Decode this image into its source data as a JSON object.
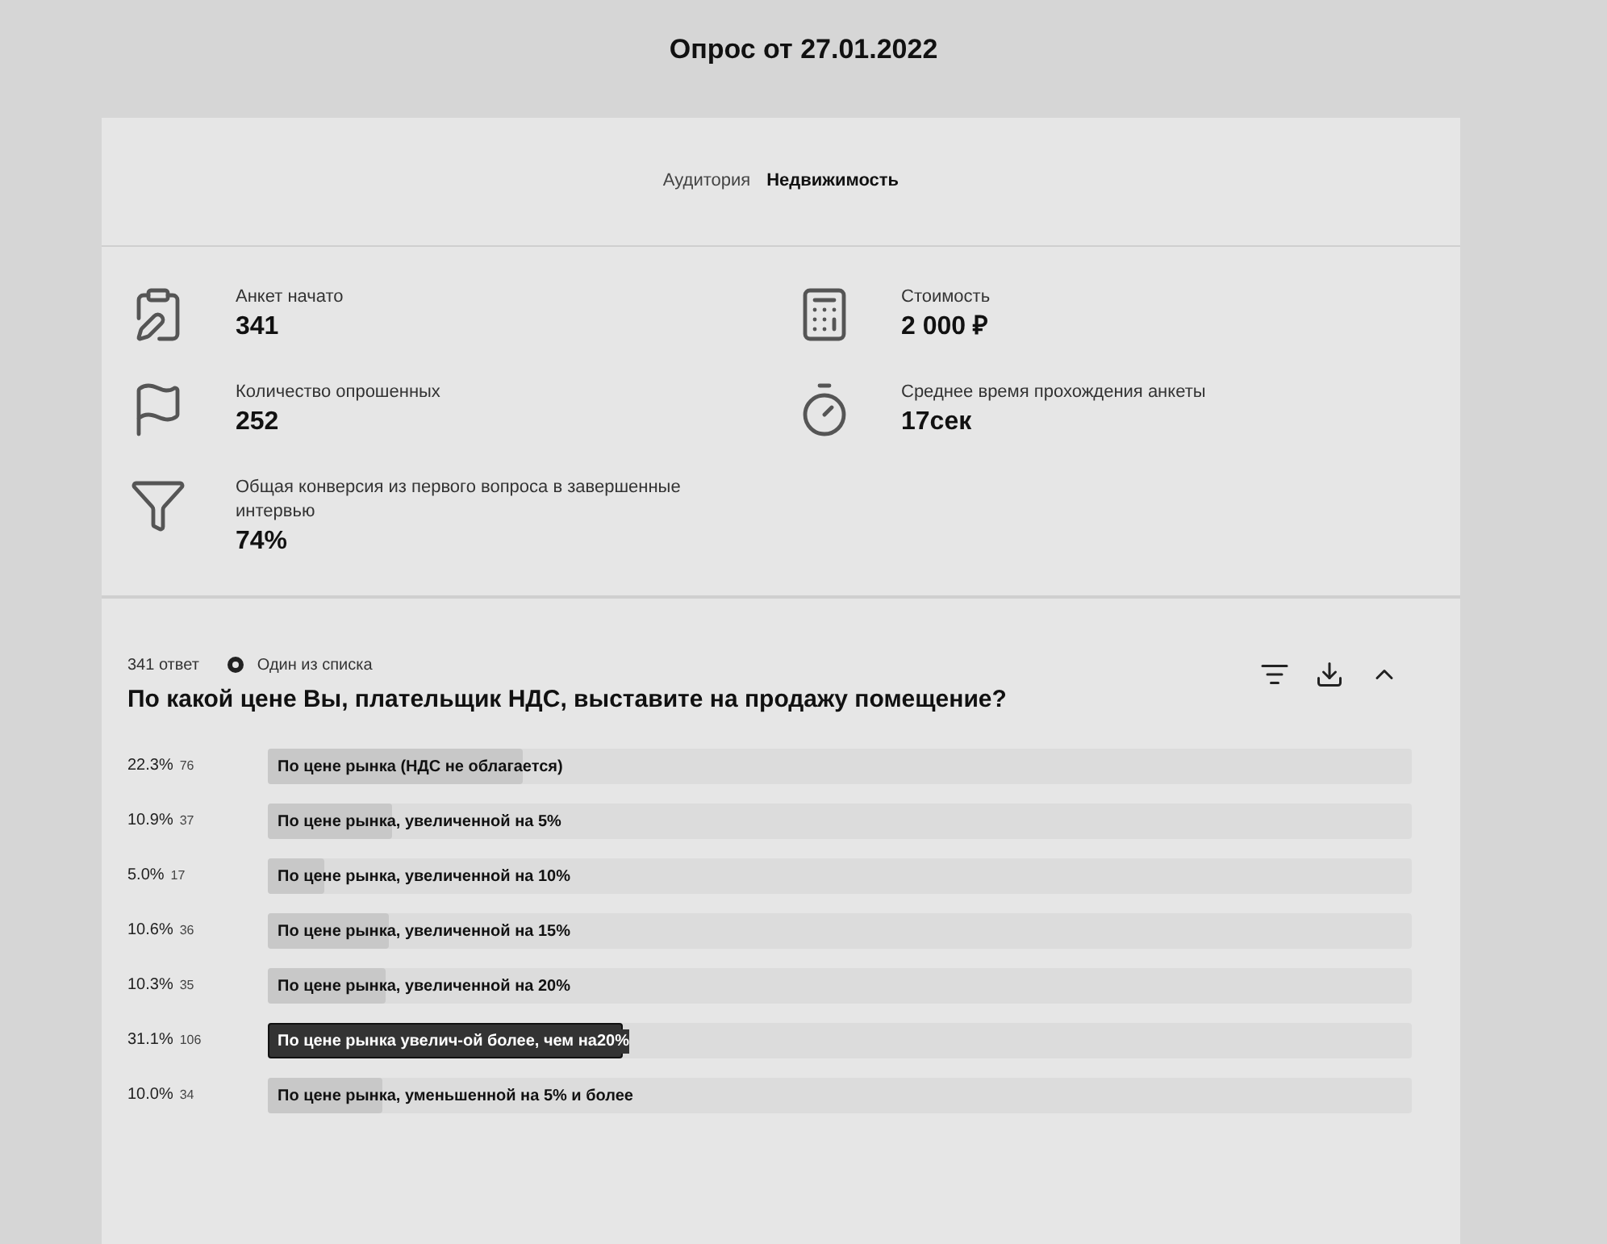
{
  "title": "Опрос от 27.01.2022",
  "tabs": [
    {
      "label": "Аудитория",
      "selected": false
    },
    {
      "label": "Недвижимость",
      "selected": true
    }
  ],
  "stats": [
    {
      "kind": "started",
      "label": "Анкет начато",
      "value": "341"
    },
    {
      "kind": "cost",
      "label": "Стоимость",
      "value": "2 000 ₽"
    },
    {
      "kind": "surveyed",
      "label": "Количество опрошенных",
      "value": "252"
    },
    {
      "kind": "time",
      "label": "Среднее время прохождения анкеты",
      "value": "17сек"
    },
    {
      "kind": "conversion",
      "label": "Общая конверсия из первого вопроса в завершенные интервью",
      "value": "74%"
    }
  ],
  "question": {
    "answers_count": "341 ответ",
    "type_label": "Один из списка",
    "text": "По какой цене Вы, плательщик НДС, выставите на продажу помещение?",
    "options": [
      {
        "percent": "22.3%",
        "count": "76",
        "label": "По цене рынка (НДС не облагается)",
        "level": 0.223,
        "selected": false
      },
      {
        "percent": "10.9%",
        "count": "37",
        "label": "По цене рынка, увеличенной на 5%",
        "level": 0.109,
        "selected": false
      },
      {
        "percent": "5.0%",
        "count": "17",
        "label": "По цене рынка, увеличенной на 10%",
        "level": 0.05,
        "selected": false
      },
      {
        "percent": "10.6%",
        "count": "36",
        "label": "По цене рынка, увеличенной на 15%",
        "level": 0.106,
        "selected": false
      },
      {
        "percent": "10.3%",
        "count": "35",
        "label": "По цене рынка, увеличенной на 20%",
        "level": 0.103,
        "selected": false
      },
      {
        "percent": "31.1%",
        "count": "106",
        "label": "По цене рынка увелич-ой более, чем на20%",
        "level": 0.311,
        "selected": true
      },
      {
        "percent": "10.0%",
        "count": "34",
        "label": "По цене рынка, уменьшенной на 5% и более",
        "level": 0.1,
        "selected": false
      }
    ]
  }
}
